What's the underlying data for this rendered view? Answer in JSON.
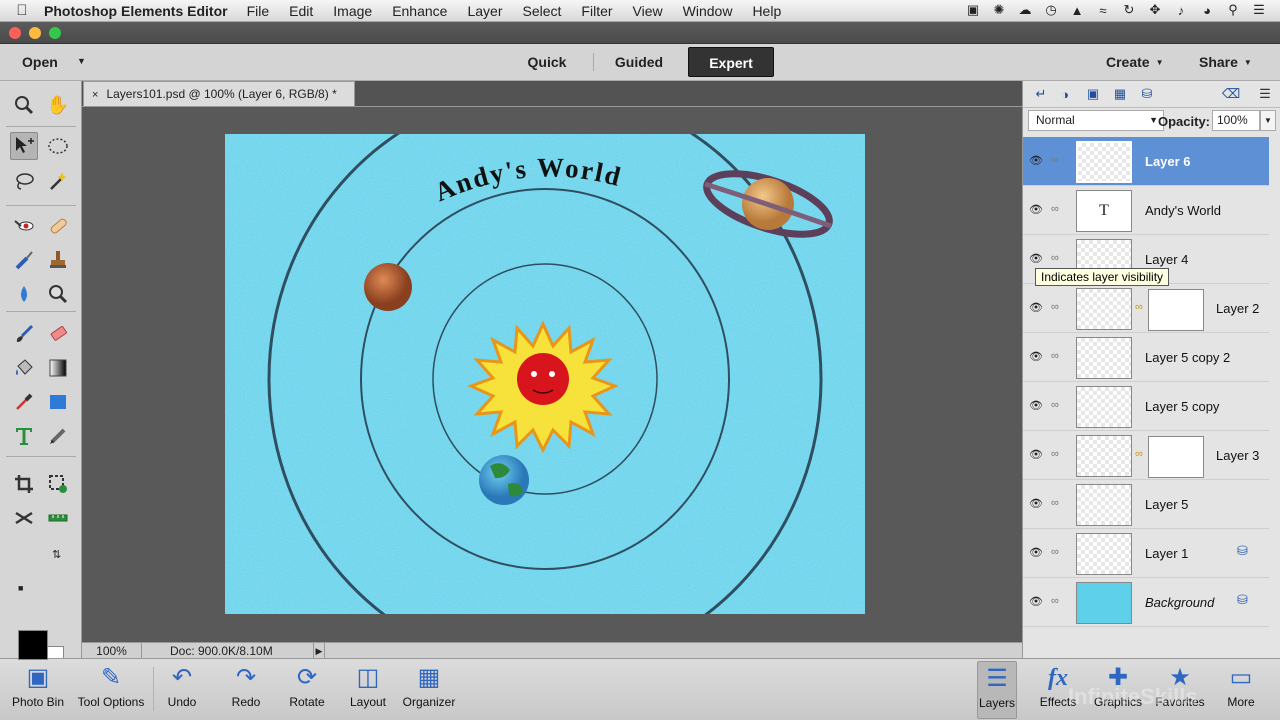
{
  "menubar": {
    "app_name": "Photoshop Elements Editor",
    "items": [
      "File",
      "Edit",
      "Image",
      "Enhance",
      "Layer",
      "Select",
      "Filter",
      "View",
      "Window",
      "Help"
    ]
  },
  "modebar": {
    "open_label": "Open",
    "tabs": [
      {
        "label": "Quick",
        "active": false
      },
      {
        "label": "Guided",
        "active": false
      },
      {
        "label": "Expert",
        "active": true
      }
    ],
    "create_label": "Create",
    "share_label": "Share"
  },
  "document": {
    "tab_title": "Layers101.psd @ 100% (Layer 6, RGB/8) *",
    "canvas_title": "Andy's World",
    "canvas_bg_color": "#5fd0ea"
  },
  "statusbar": {
    "zoom": "100%",
    "doc_info": "Doc: 900.0K/8.10M"
  },
  "layers_panel": {
    "blend_mode": "Normal",
    "opacity_label": "Opacity:",
    "opacity_value": "100%",
    "tooltip": "Indicates layer visibility",
    "layers": [
      {
        "name": "Layer 6",
        "selected": true
      },
      {
        "name": "Andy's World",
        "type": "text"
      },
      {
        "name": "Layer 4"
      },
      {
        "name": "Layer 2",
        "has_mask": true
      },
      {
        "name": "Layer 5 copy 2"
      },
      {
        "name": "Layer 5 copy"
      },
      {
        "name": "Layer 3",
        "has_mask": true
      },
      {
        "name": "Layer 5"
      },
      {
        "name": "Layer 1",
        "locked": true
      },
      {
        "name": "Background",
        "italic": true,
        "locked": true
      }
    ]
  },
  "bottombar": {
    "left": [
      {
        "label": "Photo Bin",
        "icon": "photo-bin-icon"
      },
      {
        "label": "Tool Options",
        "icon": "tool-options-icon"
      },
      {
        "label": "Undo",
        "icon": "undo-icon"
      },
      {
        "label": "Redo",
        "icon": "redo-icon"
      },
      {
        "label": "Rotate",
        "icon": "rotate-icon"
      },
      {
        "label": "Layout",
        "icon": "layout-icon"
      },
      {
        "label": "Organizer",
        "icon": "organizer-icon"
      }
    ],
    "right": [
      {
        "label": "Layers",
        "icon": "layers-icon",
        "active": true
      },
      {
        "label": "Effects",
        "icon": "fx-icon"
      },
      {
        "label": "Graphics",
        "icon": "plus-icon"
      },
      {
        "label": "Favorites",
        "icon": "star-icon"
      },
      {
        "label": "More",
        "icon": "more-icon"
      }
    ],
    "watermark": "InfiniteSkills"
  },
  "colors": {
    "foreground": "#000000",
    "background": "#ffffff",
    "selection": "#5e90d6"
  }
}
